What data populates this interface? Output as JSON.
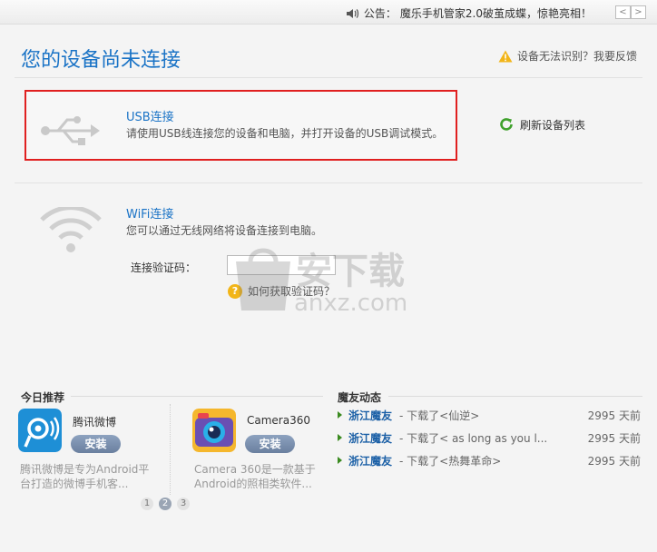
{
  "topbar": {
    "notice_prefix": "公告：",
    "notice_text": "魔乐手机管家2.0破茧成蝶，惊艳亮相！",
    "prev": "<",
    "next": ">"
  },
  "header": {
    "title": "您的设备尚未连接",
    "feedback": "设备无法识别？我要反馈"
  },
  "usb": {
    "title": "USB连接",
    "desc": "请使用USB线连接您的设备和电脑，并打开设备的USB调试模式。",
    "refresh": "刷新设备列表"
  },
  "wifi": {
    "title": "WiFi连接",
    "desc": "您可以通过无线网络将设备连接到电脑。",
    "code_label": "连接验证码：",
    "code_value": "",
    "how": "如何获取验证码？"
  },
  "watermark": {
    "text": "安下载",
    "sub": "anxz.com"
  },
  "recommend": {
    "title": "今日推荐",
    "apps": [
      {
        "name": "腾讯微博",
        "install": "安装",
        "desc": "腾讯微博是专为Android平台打造的微博手机客..."
      },
      {
        "name": "Camera360",
        "install": "安装",
        "desc": "Camera 360是一款基于Android的照相类软件..."
      }
    ],
    "pages": [
      "1",
      "2",
      "3"
    ],
    "active_page": "2"
  },
  "friends": {
    "title": "魔友动态",
    "items": [
      {
        "user": "浙江魔友",
        "action": "- 下载了<仙逆>",
        "time": "2995 天前"
      },
      {
        "user": "浙江魔友",
        "action": "- 下载了< as long as you l...",
        "time": "2995 天前"
      },
      {
        "user": "浙江魔友",
        "action": "- 下载了<热舞革命>",
        "time": "2995 天前"
      }
    ]
  },
  "colors": {
    "accent": "#1a73c6",
    "highlight_border": "#e02020",
    "user_link": "#1a5fa6"
  }
}
